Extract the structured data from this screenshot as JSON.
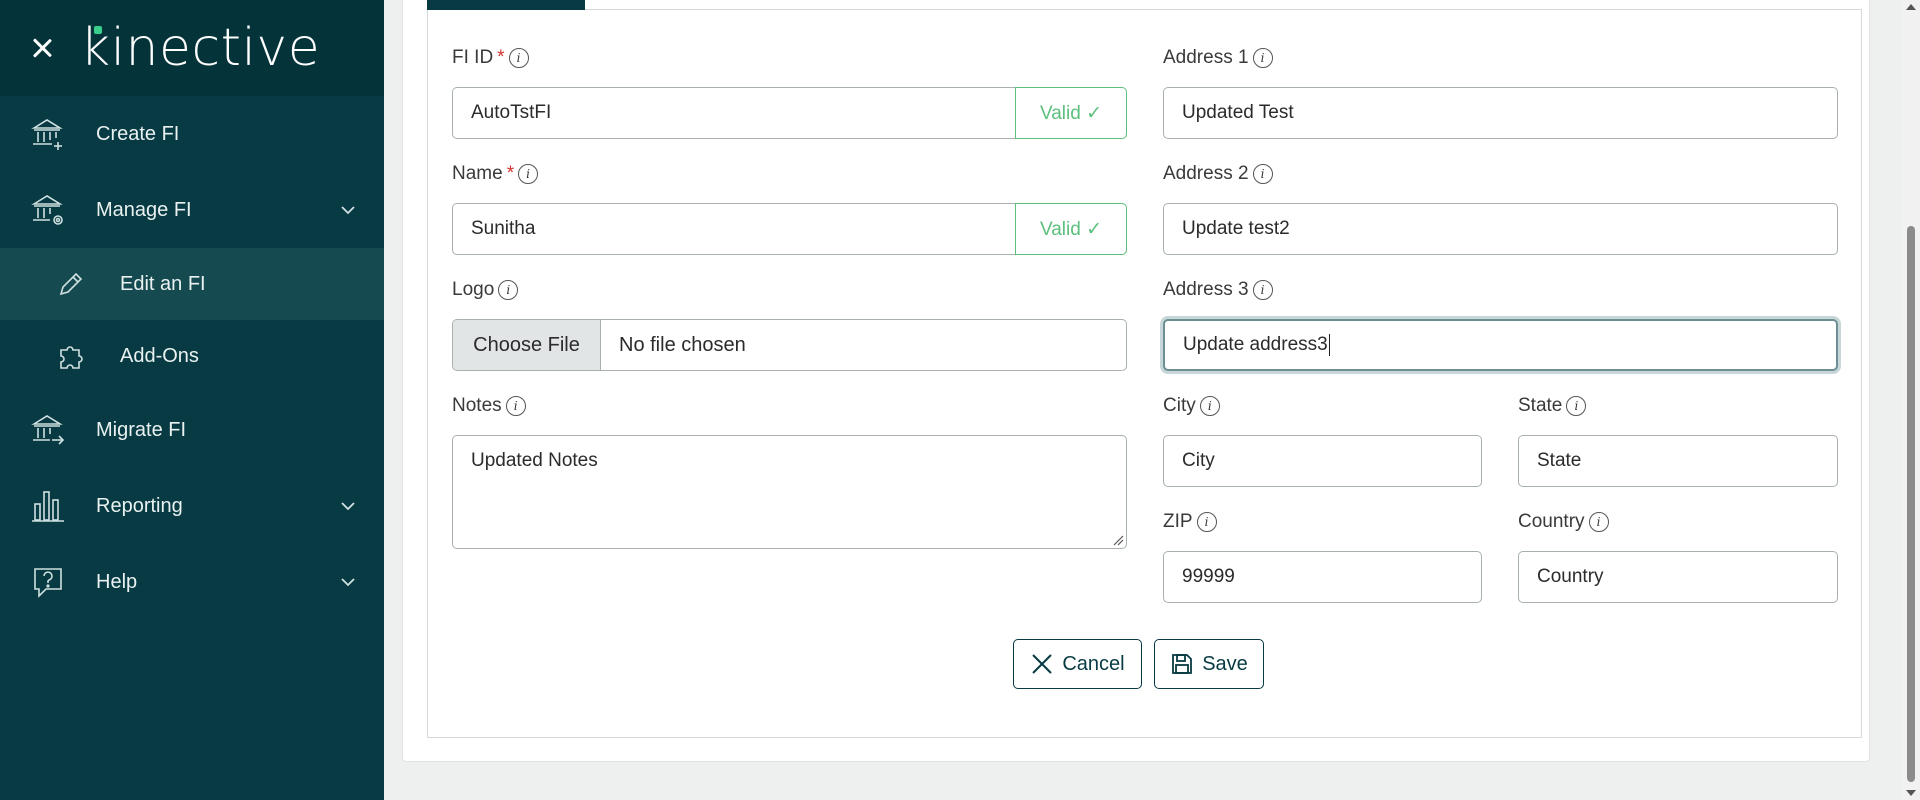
{
  "sidebar": {
    "logo": "kinective",
    "items": [
      {
        "label": "Create FI",
        "icon": "bank-plus-icon"
      },
      {
        "label": "Manage FI",
        "icon": "bank-gear-icon",
        "expanded": true
      },
      {
        "label": "Edit an FI",
        "icon": "pencil-icon",
        "active": true
      },
      {
        "label": "Add-Ons",
        "icon": "puzzle-icon"
      },
      {
        "label": "Migrate FI",
        "icon": "bank-arrow-icon"
      },
      {
        "label": "Reporting",
        "icon": "bar-chart-icon"
      },
      {
        "label": "Help",
        "icon": "help-icon"
      }
    ]
  },
  "form": {
    "fi_id": {
      "label": "FI ID",
      "value": "AutoTstFI",
      "status": "Valid ✓",
      "required": "*"
    },
    "name": {
      "label": "Name",
      "value": "Sunitha",
      "status": "Valid ✓",
      "required": "*"
    },
    "logo": {
      "label": "Logo",
      "button": "Choose File",
      "file": "No file chosen"
    },
    "notes": {
      "label": "Notes",
      "value": "Updated Notes"
    },
    "address1": {
      "label": "Address 1",
      "value": "Updated Test"
    },
    "address2": {
      "label": "Address 2",
      "value": "Update test2"
    },
    "address3": {
      "label": "Address 3",
      "value": "Update address3"
    },
    "city": {
      "label": "City",
      "value": "City"
    },
    "state": {
      "label": "State",
      "value": "State"
    },
    "zip": {
      "label": "ZIP",
      "value": "99999"
    },
    "country": {
      "label": "Country",
      "value": "Country"
    },
    "info": "i"
  },
  "actions": {
    "cancel": "Cancel",
    "save": "Save"
  },
  "colors": {
    "sidebar": "#073a42",
    "valid": "#5cbf7c",
    "accent": "#36d08a"
  }
}
